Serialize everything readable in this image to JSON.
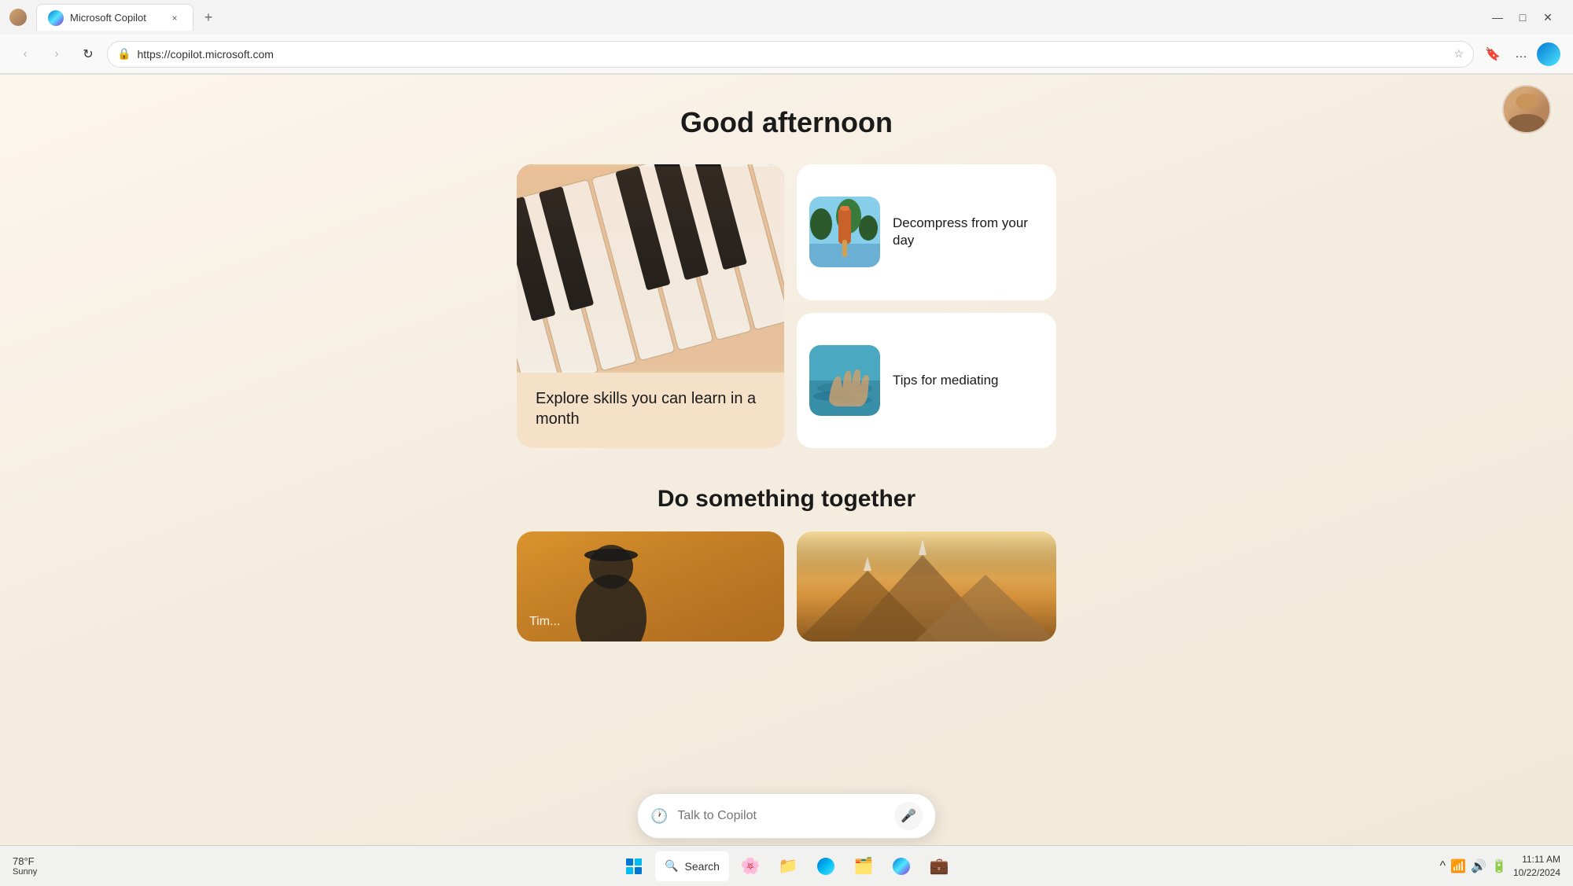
{
  "browser": {
    "url": "https://copilot.microsoft.com",
    "tab_label": "Microsoft Copilot",
    "tab_close": "×",
    "tab_new": "+",
    "nav": {
      "back": "‹",
      "forward": "›",
      "refresh": "↻",
      "home": "⌂"
    },
    "toolbar_icons": {
      "favorites_star": "☆",
      "more": "…",
      "edge_icon": "edge"
    }
  },
  "page": {
    "greeting": "Good afternoon",
    "cards": [
      {
        "id": "skills-card",
        "label": "Explore skills you can learn in a month",
        "size": "large",
        "image_type": "piano"
      },
      {
        "id": "decompress-card",
        "label": "Decompress from your day",
        "size": "small",
        "image_type": "popsicle"
      },
      {
        "id": "meditate-card",
        "label": "Tips for mediating",
        "size": "small",
        "image_type": "water"
      }
    ],
    "section2_title": "Do something together",
    "bottom_cards": [
      {
        "id": "timer-card",
        "label": "Timer",
        "image_type": "person"
      },
      {
        "id": "mountain-card",
        "label": "",
        "image_type": "mountain"
      }
    ]
  },
  "chat": {
    "placeholder": "Talk to Copilot",
    "history_icon": "🕐",
    "mic_icon": "🎤"
  },
  "taskbar": {
    "weather": {
      "temp": "78°F",
      "condition": "Sunny"
    },
    "search_label": "Search",
    "apps": [
      "windows",
      "search",
      "lotus",
      "files",
      "edge",
      "explorer",
      "edge2",
      "teams"
    ],
    "clock": {
      "time": "11:11 AM",
      "date": "10/22/2024"
    },
    "system_icons": [
      "^",
      "wifi",
      "sound",
      "battery"
    ]
  }
}
